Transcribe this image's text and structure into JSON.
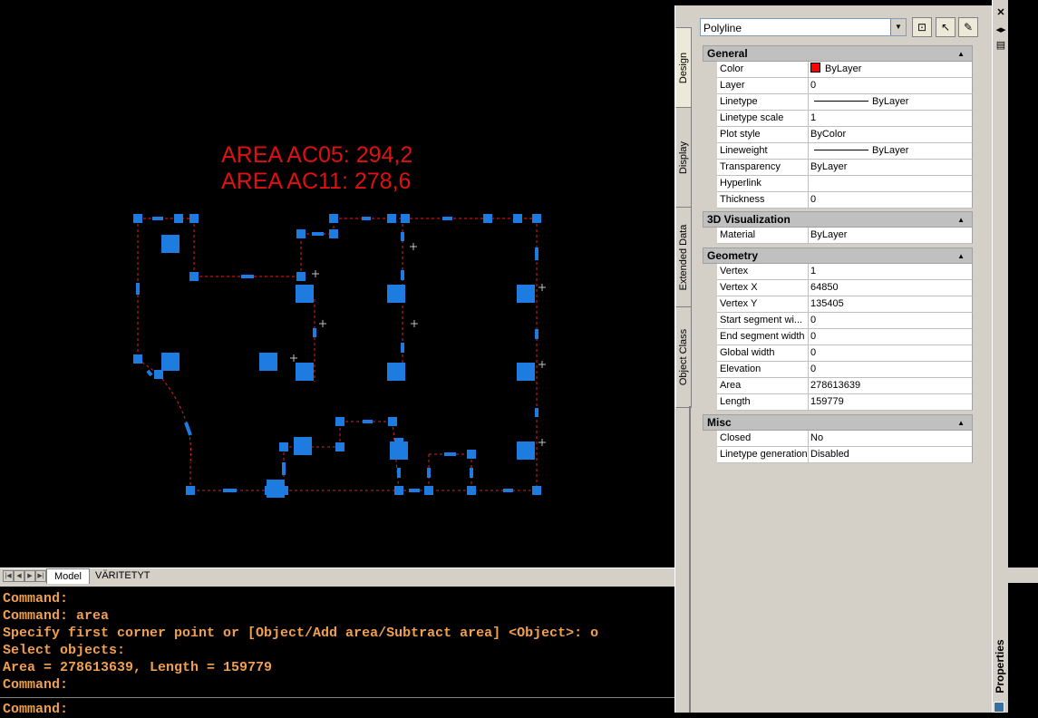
{
  "drawing": {
    "labels": [
      "AREA AC05: 294,2",
      "AREA AC11: 278,6"
    ],
    "label_color": "#e01010",
    "polyline_color": "#e02020",
    "grip_color": "#1e7be0"
  },
  "layout_tabs": {
    "active": "Model",
    "other": "VÄRITETYT"
  },
  "command_lines": [
    "Command:",
    "Command: area",
    "Specify first corner point or [Object/Add area/Subtract area] <Object>: o",
    "Select objects:",
    "Area = 278613639, Length = 159779",
    "Command:"
  ],
  "command_prompt": "Command:",
  "palette": {
    "title": "Properties",
    "object_type": "Polyline",
    "side_tabs": [
      "Design",
      "Display",
      "Extended Data",
      "Object Class"
    ],
    "toolbar_icons": [
      "quick-select-icon",
      "select-objects-icon",
      "toggle-pickadd-icon"
    ],
    "categories": [
      {
        "name": "General",
        "rows": [
          {
            "name": "Color",
            "value": "ByLayer",
            "swatch": "#ff0000"
          },
          {
            "name": "Layer",
            "value": "0"
          },
          {
            "name": "Linetype",
            "value": "ByLayer",
            "line": true
          },
          {
            "name": "Linetype scale",
            "value": "1"
          },
          {
            "name": "Plot style",
            "value": "ByColor"
          },
          {
            "name": "Lineweight",
            "value": "ByLayer",
            "line": true
          },
          {
            "name": "Transparency",
            "value": "ByLayer"
          },
          {
            "name": "Hyperlink",
            "value": ""
          },
          {
            "name": "Thickness",
            "value": "0"
          }
        ]
      },
      {
        "name": "3D Visualization",
        "rows": [
          {
            "name": "Material",
            "value": "ByLayer"
          }
        ]
      },
      {
        "name": "Geometry",
        "rows": [
          {
            "name": "Vertex",
            "value": "1"
          },
          {
            "name": "Vertex X",
            "value": "64850"
          },
          {
            "name": "Vertex Y",
            "value": "135405"
          },
          {
            "name": "Start segment wi...",
            "value": "0"
          },
          {
            "name": "End segment width",
            "value": "0"
          },
          {
            "name": "Global width",
            "value": "0"
          },
          {
            "name": "Elevation",
            "value": "0"
          },
          {
            "name": "Area",
            "value": "278613639"
          },
          {
            "name": "Length",
            "value": "159779"
          }
        ]
      },
      {
        "name": "Misc",
        "rows": [
          {
            "name": "Closed",
            "value": "No"
          },
          {
            "name": "Linetype generation",
            "value": "Disabled"
          }
        ]
      }
    ]
  }
}
